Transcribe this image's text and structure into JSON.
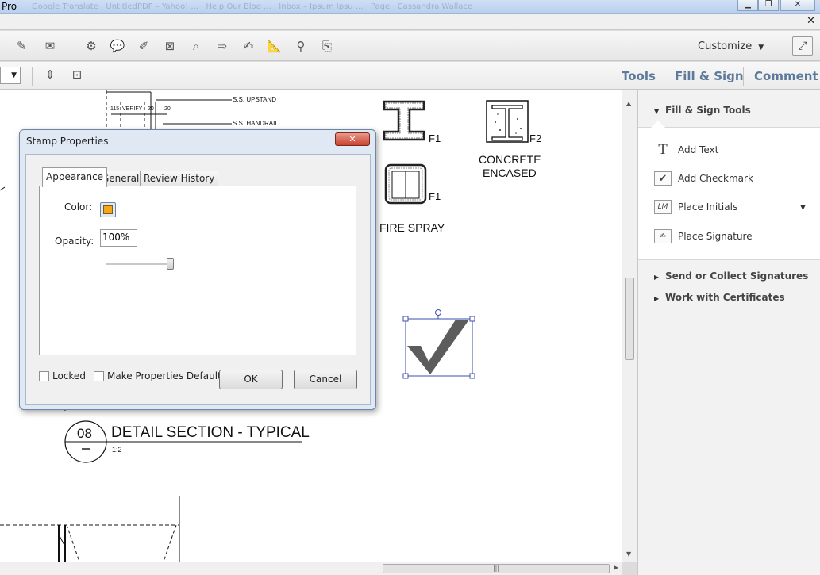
{
  "window": {
    "title": "Pro",
    "faint_tabs": "Google Translate   ·   UntitledPDF – Yahoo! ...   ·   Help Our Blog ...   ·   Inbox – Ipsum Ipsu ...   ·   Page · Cassandra Wallace"
  },
  "toolbar": {
    "customize_label": "Customize",
    "tabs": {
      "tools": "Tools",
      "fill_sign": "Fill & Sign",
      "comment": "Comment"
    }
  },
  "drawing": {
    "labels": {
      "ss_upstand": "S.S. UPSTAND",
      "ss_handrail": "S.S. HANDRAIL",
      "dim_115": "115",
      "dim_verify": "VERIFY",
      "dim_20a": "20",
      "dim_20b": "20",
      "f1_top": "F1",
      "f1_mid": "F1",
      "f2": "F2",
      "concrete": "CONCRETE",
      "encased": "ENCASED",
      "fire_spray": "FIRE SPRAY",
      "section_number": "08",
      "section_title": "DETAIL SECTION - TYPICAL",
      "scale": "1:2"
    }
  },
  "right_panel": {
    "fill_sign_tools": "Fill & Sign Tools",
    "items": [
      {
        "label": "Add Text",
        "icon": "text-T-icon"
      },
      {
        "label": "Add Checkmark",
        "icon": "checkmark-icon"
      },
      {
        "label": "Place Initials",
        "icon": "initials-icon",
        "icon_text": "LM"
      },
      {
        "label": "Place Signature",
        "icon": "signature-icon"
      }
    ],
    "send_collect": "Send or Collect Signatures",
    "certificates": "Work with Certificates"
  },
  "dialog": {
    "title": "Stamp Properties",
    "tabs": [
      "Appearance",
      "General",
      "Review History"
    ],
    "color_label": "Color:",
    "color_value": "#f3a71c",
    "opacity_label": "Opacity:",
    "opacity_value": "100%",
    "opacity_level": 1.0,
    "locked_label": "Locked",
    "default_label": "Make Properties Default",
    "ok_label": "OK",
    "cancel_label": "Cancel"
  }
}
